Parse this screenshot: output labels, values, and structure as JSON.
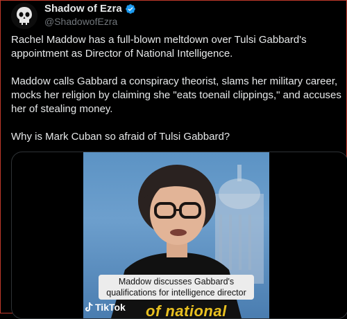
{
  "tweet": {
    "display_name": "Shadow of Ezra",
    "handle": "@ShadowofEzra",
    "verified_icon": "verified-badge-icon",
    "verified_color": "#1d9bf0",
    "text_lines": [
      "Rachel Maddow has a full-blown meltdown over Tulsi Gabbard's",
      "appointment as Director of National Intelligence.",
      "Maddow calls Gabbard a conspiracy theorist, slams her military career,",
      "mocks her religion by claiming she \"eats toenail clippings,\" and accuses",
      "her of stealing money.",
      "Why is Mark Cuban so afraid of Tulsi Gabbard?"
    ]
  },
  "media": {
    "caption_line1": "Maddow discusses Gabbard's",
    "caption_line2": "qualifications for intelligence director",
    "watermark": "TikTok",
    "overlay_text": "of national"
  }
}
